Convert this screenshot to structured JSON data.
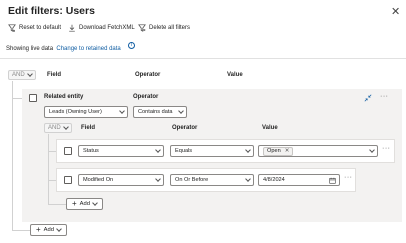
{
  "dialog": {
    "title": "Edit filters: Users"
  },
  "toolbar": {
    "reset_label": "Reset to default",
    "download_label": "Download FetchXML",
    "delete_label": "Delete all filters"
  },
  "live_data": {
    "text": "Showing live data",
    "link": "Change to retained data"
  },
  "root_group": {
    "operator": "AND",
    "headers": {
      "field": "Field",
      "operator": "Operator",
      "value": "Value"
    },
    "add_label": "Add"
  },
  "related_entity": {
    "label": "Related entity",
    "operator_label": "Operator",
    "entity_value": "Leads (Owning User)",
    "operator_value": "Contains data",
    "inner_group": {
      "operator": "AND",
      "headers": {
        "field": "Field",
        "operator": "Operator",
        "value": "Value"
      },
      "rows": [
        {
          "field": "Status",
          "operator": "Equals",
          "value_tag": "Open"
        },
        {
          "field": "Modified On",
          "operator": "On Or Before",
          "value_date": "4/8/2024"
        }
      ],
      "add_label": "Add"
    }
  },
  "icons": {
    "reset": "filter-reset-icon",
    "download": "download-icon",
    "delete": "delete-filter-icon",
    "info": "info-icon",
    "collapse": "collapse-arrows-icon",
    "more": "more-icon",
    "calendar": "calendar-icon",
    "plus": "plus-icon"
  },
  "colors": {
    "link": "#115ea3",
    "panel_bg": "#f3f2f1"
  }
}
